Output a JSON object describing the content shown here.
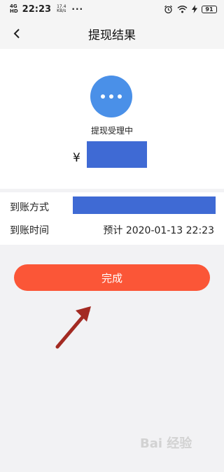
{
  "status_bar": {
    "network": "4G",
    "signal_sub": "HD",
    "time": "22:23",
    "speed_value": "17.4",
    "speed_unit": "KB/s",
    "more": "···",
    "battery": "91"
  },
  "nav": {
    "back_icon": "chevron-left-icon",
    "title": "提现结果"
  },
  "result": {
    "status_icon": "more-dots-icon",
    "status_color": "#4a90e8",
    "status_text": "提现受理中",
    "currency": "¥",
    "amount": "[redacted]"
  },
  "details": {
    "method_label": "到账方式",
    "method_value": "[redacted]",
    "time_label": "到账时间",
    "time_value": "预计 2020-01-13 22:23"
  },
  "actions": {
    "done_label": "完成",
    "done_color": "#fb5637"
  },
  "watermark": "Bai 经验"
}
